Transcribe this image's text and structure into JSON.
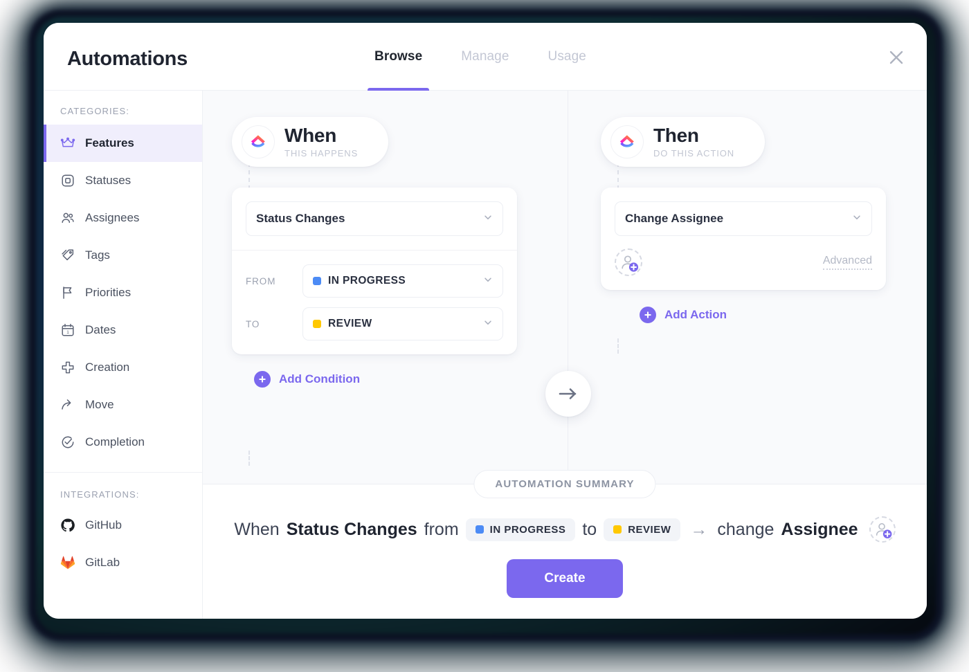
{
  "window": {
    "title": "Automations",
    "close_label": "×"
  },
  "tabs": [
    {
      "label": "Browse",
      "active": true
    },
    {
      "label": "Manage",
      "active": false
    },
    {
      "label": "Usage",
      "active": false
    }
  ],
  "sidebar": {
    "categories_heading": "CATEGORIES:",
    "items": [
      {
        "label": "Features",
        "icon": "crown-icon",
        "active": true
      },
      {
        "label": "Statuses",
        "icon": "square-outline-icon",
        "active": false
      },
      {
        "label": "Assignees",
        "icon": "people-icon",
        "active": false
      },
      {
        "label": "Tags",
        "icon": "tag-icon",
        "active": false
      },
      {
        "label": "Priorities",
        "icon": "flag-icon",
        "active": false
      },
      {
        "label": "Dates",
        "icon": "calendar-icon",
        "active": false
      },
      {
        "label": "Creation",
        "icon": "plus-cross-icon",
        "active": false
      },
      {
        "label": "Move",
        "icon": "arrow-move-icon",
        "active": false
      },
      {
        "label": "Completion",
        "icon": "check-circle-icon",
        "active": false
      }
    ],
    "integrations_heading": "INTEGRATIONS:",
    "integrations": [
      {
        "label": "GitHub",
        "icon": "github-icon"
      },
      {
        "label": "GitLab",
        "icon": "gitlab-icon"
      }
    ]
  },
  "builder": {
    "when": {
      "title": "When",
      "subtitle": "THIS HAPPENS",
      "trigger": "Status Changes",
      "conditions": [
        {
          "label": "FROM",
          "value": "IN PROGRESS",
          "color": "#4c8bf5"
        },
        {
          "label": "TO",
          "value": "REVIEW",
          "color": "#ffc800"
        }
      ],
      "add_condition": "Add Condition"
    },
    "then": {
      "title": "Then",
      "subtitle": "DO THIS ACTION",
      "action": "Change Assignee",
      "advanced": "Advanced",
      "add_action": "Add Action"
    },
    "transition_arrow": "→"
  },
  "summary": {
    "badge": "AUTOMATION SUMMARY",
    "prefix": "When",
    "trigger": "Status Changes",
    "from_word": "from",
    "from_status": "IN PROGRESS",
    "from_color": "#4c8bf5",
    "to_word": "to",
    "to_status": "REVIEW",
    "to_color": "#ffc800",
    "arrow": "→",
    "action_verb": "change",
    "action_object": "Assignee",
    "create_label": "Create"
  },
  "theme": {
    "accent": "#7b68ee",
    "muted": "#9ba1b0",
    "surface": "#f9fafc"
  }
}
